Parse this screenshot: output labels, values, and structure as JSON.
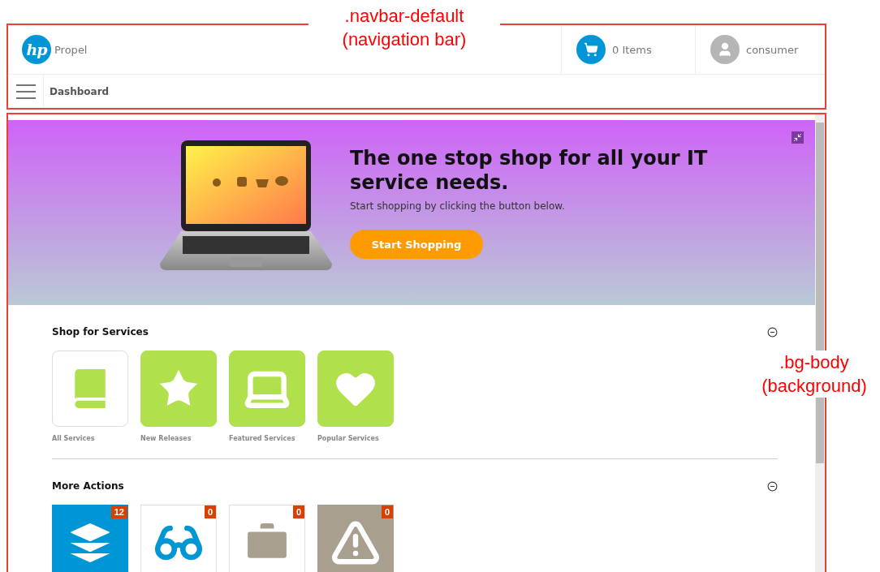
{
  "annotations": [
    {
      "kind": "top",
      "lines": [
        ".navbar-default",
        "(navigation bar)"
      ]
    },
    {
      "kind": "side",
      "lines": [
        ".bg-body",
        "(background)"
      ]
    }
  ],
  "navbar": {
    "logo": "hp",
    "brand": "Propel",
    "cart": "0 Items",
    "user": "consumer",
    "breadcrumb": "Dashboard"
  },
  "hero": {
    "title": "The one stop shop for all your IT service needs.",
    "subtitle": "Start shopping by clicking the button below.",
    "button": "Start Shopping"
  },
  "sections": [
    {
      "title": "Shop for Services",
      "expanded": true,
      "tiles": [
        {
          "label": "All Services",
          "kind": "outline",
          "color": "#b0e04c"
        },
        {
          "label": "New Releases",
          "kind": "filled",
          "color": "#b0e04c"
        },
        {
          "label": "Featured Services",
          "kind": "filled",
          "color": "#b0e04c"
        },
        {
          "label": "Popular Services",
          "kind": "filled",
          "color": "#b0e04c"
        }
      ]
    },
    {
      "title": "More Actions",
      "expanded": true,
      "tiles": [
        {
          "badge": "12",
          "kind": "filled",
          "color": "#0096d6"
        },
        {
          "badge": "0",
          "kind": "outline",
          "color": "#0096d6"
        },
        {
          "badge": "0",
          "kind": "outline",
          "color": "#a89f8f"
        },
        {
          "badge": "0",
          "kind": "filled",
          "color": "#a89f8f"
        }
      ]
    }
  ]
}
